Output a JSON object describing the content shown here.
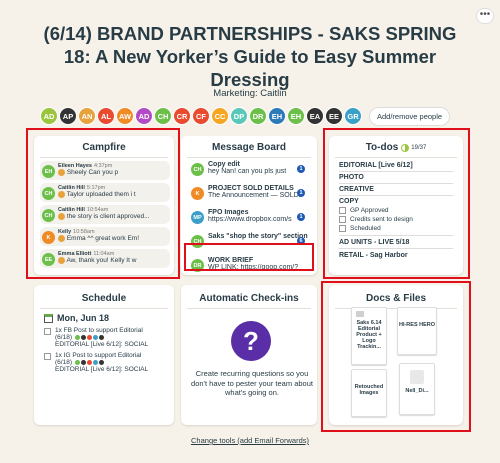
{
  "header": {
    "title": "(6/14) BRAND PARTNERSHIPS - SAKS SPRING 18: A New Yorker’s Guide to Easy Summer Dressing",
    "subtitle": "Marketing: Caitlin",
    "more_icon": "ellipsis-icon",
    "more_label": "•••"
  },
  "people": [
    {
      "initials": "AD",
      "color": "#9bc53d"
    },
    {
      "initials": "AP",
      "color": "#333333"
    },
    {
      "initials": "AN",
      "color": "#e8a23c"
    },
    {
      "initials": "AL",
      "color": "#e84b2f"
    },
    {
      "initials": "AW",
      "color": "#f08a24"
    },
    {
      "initials": "AD",
      "color": "#b44bc4"
    },
    {
      "initials": "CH",
      "color": "#6cc04a"
    },
    {
      "initials": "CR",
      "color": "#e84b2f"
    },
    {
      "initials": "CF",
      "color": "#e84b2f"
    },
    {
      "initials": "CC",
      "color": "#f5a623"
    },
    {
      "initials": "DP",
      "color": "#5ac8b8"
    },
    {
      "initials": "DR",
      "color": "#6cc04a"
    },
    {
      "initials": "EH",
      "color": "#2d7ab8"
    },
    {
      "initials": "EH",
      "color": "#6cc04a"
    },
    {
      "initials": "EA",
      "color": "#333333"
    },
    {
      "initials": "EE",
      "color": "#333333"
    },
    {
      "initials": "GR",
      "color": "#3aa0c8"
    }
  ],
  "add_remove_label": "Add/remove people",
  "campfire": {
    "title": "Campfire",
    "messages": [
      {
        "initials": "EH",
        "color": "#6cc04a",
        "name": "Eileen Hayes",
        "time": "4:37pm",
        "text": "Sheely Can you p"
      },
      {
        "initials": "CH",
        "color": "#6cc04a",
        "name": "Caitlin Hill",
        "time": "5:17pm",
        "text": "Taylor uploaded them i t"
      },
      {
        "initials": "CH",
        "color": "#6cc04a",
        "name": "Caitlin Hill",
        "time": "10:54am",
        "text": "the story is client approved..."
      },
      {
        "initials": "K",
        "color": "#f08a24",
        "name": "Kelly",
        "time": "10:58am",
        "text": "Emma ^^ great work Em!"
      },
      {
        "initials": "EE",
        "color": "#6cc04a",
        "name": "Emma Elliott",
        "time": "11:04am",
        "text": "Aw, thank you! Kelly It w"
      }
    ]
  },
  "message_board": {
    "title": "Message Board",
    "items": [
      {
        "initials": "CH",
        "color": "#6cc04a",
        "title": "Copy edit",
        "sub": "hey Nan! can you pls just",
        "badge": "1"
      },
      {
        "initials": "K",
        "color": "#f08a24",
        "title": "PROJECT SOLD DETAILS",
        "sub": "The Announcement — SOLD:",
        "badge": "1"
      },
      {
        "initials": "MP",
        "color": "#3aa0c8",
        "title": "FPO Images",
        "sub": "https://www.dropbox.com/s",
        "badge": "1"
      },
      {
        "initials": "CH",
        "color": "#6cc04a",
        "title": "Saks \"shop the story\" section",
        "sub": "",
        "badge": "6"
      },
      {
        "initials": "DR",
        "color": "#6cc04a",
        "title": "WORK BRIEF",
        "sub": "WP LINK: https://goop.com/?",
        "badge": ""
      }
    ]
  },
  "todos": {
    "title": "To-dos",
    "progress_label": "19/37",
    "progress_fraction": 0.51,
    "list1_title": "EDITORIAL [Live 6/12]",
    "groups": [
      "PHOTO",
      "CREATIVE",
      "COPY"
    ],
    "items": [
      "GP Approved",
      "Credits sent to design",
      "Scheduled"
    ],
    "list2_title": "AD UNITS - LIVE 5/18",
    "list3_title": "RETAIL - Sag Harbor"
  },
  "schedule": {
    "title": "Schedule",
    "date": "Mon, Jun 18",
    "events": [
      {
        "line1": "1x FB Post to support Editorial",
        "line2": "(6/18)",
        "line3": "EDITORIAL [Live 6/12]: SOCIAL"
      },
      {
        "line1": "1x IG Post to support Editorial",
        "line2": "(6/18)",
        "line3": "EDITORIAL [Live 6/12]: SOCIAL"
      }
    ]
  },
  "checkins": {
    "title": "Automatic Check-ins",
    "icon": "question-icon",
    "icon_label": "?",
    "text": "Create recurring questions so you don't have to pester your team about what's going on."
  },
  "docs": {
    "title": "Docs & Files",
    "files": [
      {
        "label": "Saks 6.14 Editorial Product + Logo Trackin..."
      },
      {
        "label": "HI-RES HERO"
      },
      {
        "label": "Retouched Images"
      },
      {
        "label": "Nell_Di..."
      }
    ]
  },
  "footer": {
    "link": "Change tools (add Email Forwards)"
  },
  "colors": {
    "highlight": "#e0101a",
    "background": "#f6f2e9",
    "accent_purple": "#5a2ea6"
  }
}
